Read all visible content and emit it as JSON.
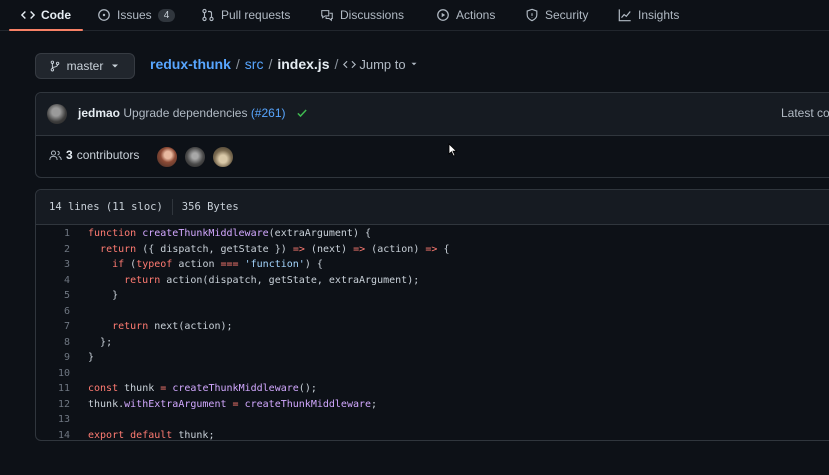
{
  "tabs": [
    {
      "label": "Code",
      "icon": "code-icon",
      "active": true
    },
    {
      "label": "Issues",
      "icon": "issue-icon",
      "count": "4"
    },
    {
      "label": "Pull requests",
      "icon": "pull-request-icon"
    },
    {
      "label": "Discussions",
      "icon": "discussion-icon"
    },
    {
      "label": "Actions",
      "icon": "play-icon"
    },
    {
      "label": "Security",
      "icon": "shield-icon"
    },
    {
      "label": "Insights",
      "icon": "graph-icon"
    }
  ],
  "branch": {
    "name": "master"
  },
  "breadcrumb": {
    "repo": "redux-thunk",
    "dir": "src",
    "file": "index.js",
    "sep": "/",
    "jump": "Jump to"
  },
  "commit": {
    "author": "jedmao",
    "message": "Upgrade dependencies",
    "pr": "(#261)",
    "latest": "Latest co",
    "contributors_count": "3",
    "contributors_label": "contributors"
  },
  "file": {
    "lines_info": "14 lines (11 sloc)",
    "size": "356 Bytes"
  },
  "code": [
    "function createThunkMiddleware(extraArgument) {",
    "  return ({ dispatch, getState }) => (next) => (action) => {",
    "    if (typeof action === 'function') {",
    "      return action(dispatch, getState, extraArgument);",
    "    }",
    "",
    "    return next(action);",
    "  };",
    "}",
    "",
    "const thunk = createThunkMiddleware();",
    "thunk.withExtraArgument = createThunkMiddleware;",
    "",
    "export default thunk;"
  ],
  "colors": {
    "background": "#0d1117",
    "link": "#58a6ff",
    "keyword": "#ff7b72",
    "function": "#d2a8ff",
    "string": "#a5d6ff",
    "active_tab": "#f78166",
    "success": "#3fb950"
  }
}
